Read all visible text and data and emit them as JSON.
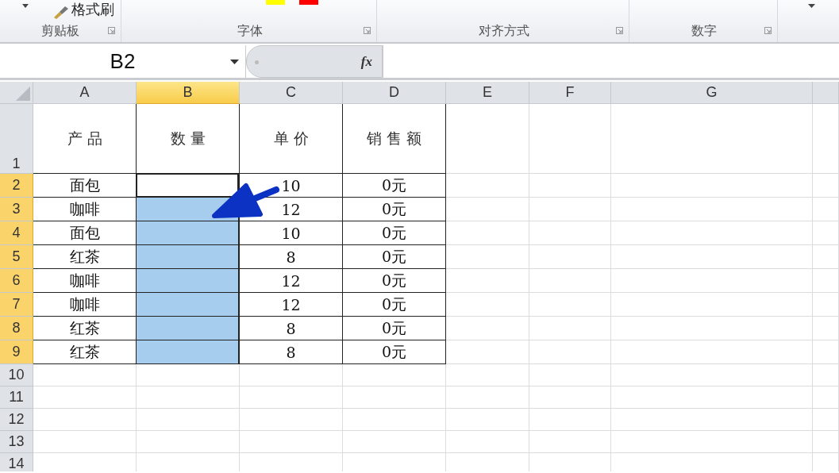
{
  "ribbon": {
    "format_painter": "格式刷",
    "groups": [
      {
        "label": "剪贴板"
      },
      {
        "label": "字体"
      },
      {
        "label": "对齐方式"
      },
      {
        "label": "数字"
      }
    ]
  },
  "name_box": {
    "value": "B2"
  },
  "formula_bar": {
    "fx_label": "fx"
  },
  "columns": [
    {
      "label": "A",
      "selected": false
    },
    {
      "label": "B",
      "selected": true
    },
    {
      "label": "C",
      "selected": false
    },
    {
      "label": "D",
      "selected": false
    },
    {
      "label": "E",
      "selected": false
    },
    {
      "label": "F",
      "selected": false
    },
    {
      "label": "G",
      "selected": false
    }
  ],
  "rows": [
    {
      "header": "1",
      "selected": false,
      "product": "产品",
      "quantity": "数量",
      "price": "单价",
      "sales": "销售额"
    },
    {
      "header": "2",
      "selected": true,
      "product": "面包",
      "price": "10",
      "sales": "0元"
    },
    {
      "header": "3",
      "selected": true,
      "product": "咖啡",
      "price": "12",
      "sales": "0元"
    },
    {
      "header": "4",
      "selected": true,
      "product": "面包",
      "price": "10",
      "sales": "0元"
    },
    {
      "header": "5",
      "selected": true,
      "product": "红茶",
      "price": "8",
      "sales": "0元"
    },
    {
      "header": "6",
      "selected": true,
      "product": "咖啡",
      "price": "12",
      "sales": "0元"
    },
    {
      "header": "7",
      "selected": true,
      "product": "咖啡",
      "price": "12",
      "sales": "0元"
    },
    {
      "header": "8",
      "selected": true,
      "product": "红茶",
      "price": "8",
      "sales": "0元"
    },
    {
      "header": "9",
      "selected": true,
      "product": "红茶",
      "price": "8",
      "sales": "0元"
    },
    {
      "header": "10",
      "selected": false
    },
    {
      "header": "11",
      "selected": false
    },
    {
      "header": "12",
      "selected": false
    },
    {
      "header": "13",
      "selected": false
    },
    {
      "header": "14",
      "selected": false
    }
  ]
}
